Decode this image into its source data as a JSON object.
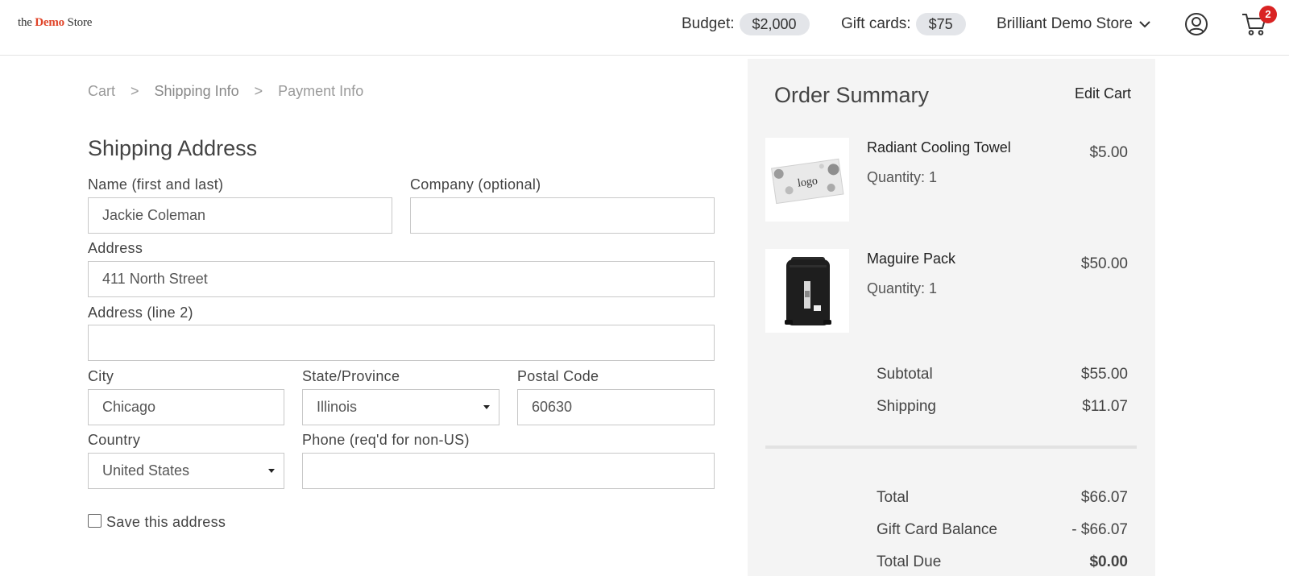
{
  "header": {
    "logo": {
      "the": "the",
      "demo": "Demo",
      "store": "Store"
    },
    "budget_label": "Budget:",
    "budget_value": "$2,000",
    "gift_cards_label": "Gift cards:",
    "gift_cards_value": "$75",
    "store_name": "Brilliant Demo Store",
    "cart_count": "2"
  },
  "breadcrumb": [
    {
      "label": "Cart"
    },
    {
      "label": ">"
    },
    {
      "label": "Shipping Info"
    },
    {
      "label": ">"
    },
    {
      "label": "Payment Info"
    }
  ],
  "form": {
    "title": "Shipping Address",
    "name_label": "Name (first and last)",
    "name_value": "Jackie Coleman",
    "company_label": "Company (optional)",
    "company_value": "",
    "address_label": "Address",
    "address_value": "411 North Street",
    "address2_label": "Address (line 2)",
    "address2_value": "",
    "city_label": "City",
    "city_value": "Chicago",
    "state_label": "State/Province",
    "state_value": "Illinois",
    "postal_label": "Postal Code",
    "postal_value": "60630",
    "country_label": "Country",
    "country_value": "United States",
    "phone_label": "Phone (req'd for non-US)",
    "phone_value": "",
    "save_label": "Save this address"
  },
  "summary": {
    "title": "Order Summary",
    "edit_cart": "Edit Cart",
    "items": [
      {
        "name": "Radiant Cooling Towel",
        "quantity": "Quantity: 1",
        "price": "$5.00",
        "image_text": "logo"
      },
      {
        "name": "Maguire Pack",
        "quantity": "Quantity: 1",
        "price": "$50.00"
      }
    ],
    "subtotal_label": "Subtotal",
    "subtotal_value": "$55.00",
    "shipping_label": "Shipping",
    "shipping_value": "$11.07",
    "total_label": "Total",
    "total_value": "$66.07",
    "gift_card_label": "Gift Card Balance",
    "gift_card_value": "- $66.07",
    "due_label": "Total Due",
    "due_value": "$0.00"
  }
}
